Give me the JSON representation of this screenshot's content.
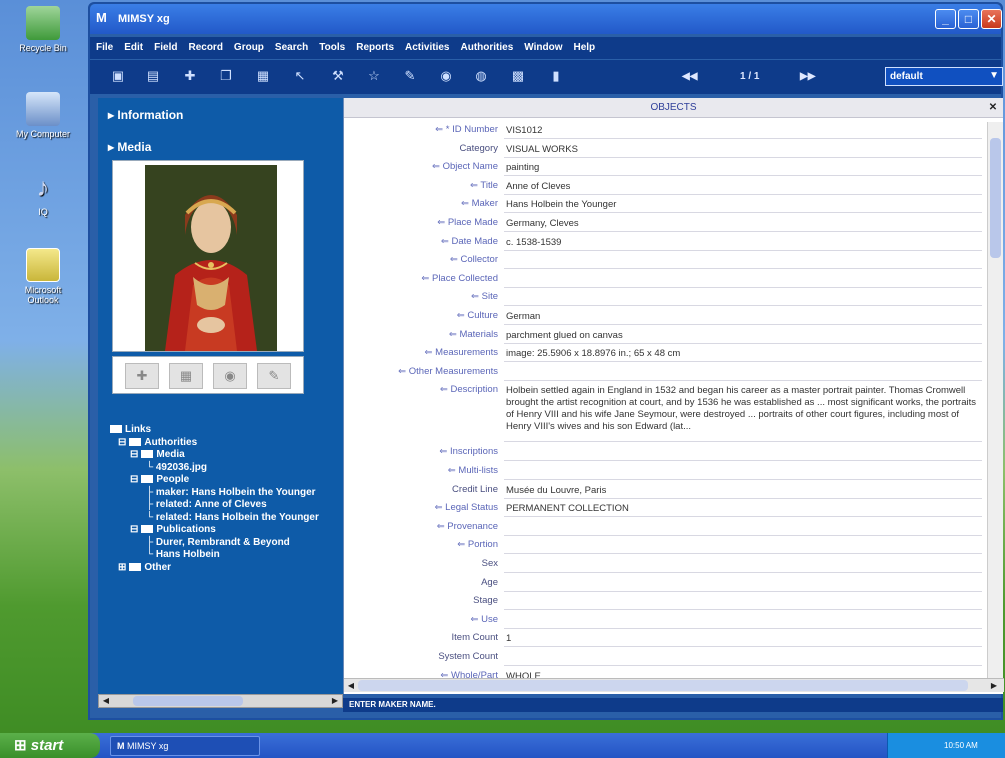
{
  "desktop": {
    "icons": [
      {
        "label": "Recycle Bin"
      },
      {
        "label": "My Computer"
      },
      {
        "label": "IQ"
      },
      {
        "label": "Microsoft Outlook"
      }
    ]
  },
  "window": {
    "app_icon_letter": "M",
    "title": "MIMSY xg",
    "min_glyph": "_",
    "max_glyph": "□",
    "close_glyph": "✕"
  },
  "menu": [
    "File",
    "Edit",
    "Field",
    "Record",
    "Group",
    "Search",
    "Tools",
    "Reports",
    "Activities",
    "Authorities",
    "Window",
    "Help"
  ],
  "toolbar": {
    "first_glyph": "◀◀",
    "page_indicator": "1 / 1",
    "last_glyph": "▶▶",
    "profile_value": "default",
    "dropdown_glyph": "▼"
  },
  "left_panel": {
    "information_label": "Information",
    "media_label": "Media",
    "links_label": "Links",
    "authorities_label": "Authorities",
    "media_folder": "Media",
    "media_file": "492036.jpg",
    "people_label": "People",
    "people": [
      "maker: Hans Holbein the Younger",
      "related: Anne of Cleves",
      "related: Hans Holbein the Younger"
    ],
    "publications_label": "Publications",
    "publications": [
      "Durer, Rembrandt & Beyond",
      "Hans Holbein"
    ],
    "other_label": "Other"
  },
  "objects": {
    "header": "OBJECTS",
    "close_glyph": "✕",
    "fields": [
      {
        "label": "* ID Number",
        "value": "VIS1012",
        "link": true
      },
      {
        "label": "Category",
        "value": "VISUAL WORKS",
        "link": false
      },
      {
        "label": "Object Name",
        "value": "painting",
        "link": true
      },
      {
        "label": "Title",
        "value": "Anne of Cleves",
        "link": true
      },
      {
        "label": "Maker",
        "value": "Hans Holbein the Younger",
        "link": true
      },
      {
        "label": "Place Made",
        "value": "Germany, Cleves",
        "link": true
      },
      {
        "label": "Date Made",
        "value": "c. 1538-1539",
        "link": true
      },
      {
        "label": "Collector",
        "value": "",
        "link": true
      },
      {
        "label": "Place Collected",
        "value": "",
        "link": true
      },
      {
        "label": "Site",
        "value": "",
        "link": true
      },
      {
        "label": "Culture",
        "value": "German",
        "link": true
      },
      {
        "label": "Materials",
        "value": "parchment glued on canvas",
        "link": true
      },
      {
        "label": "Measurements",
        "value": "image: 25.5906 x 18.8976 in.; 65 x 48 cm",
        "link": true
      },
      {
        "label": "Other Measurements",
        "value": "",
        "link": true
      },
      {
        "label": "Description",
        "value": "Holbein settled again in England in 1532 and began his career as a master portrait painter. Thomas Cromwell brought the artist recognition at court, and by 1536 he was established as ... most significant works, the portraits of Henry VIII and his wife Jane Seymour, were destroyed ... portraits of other court figures, including most of Henry VIII's wives and his son Edward (lat...",
        "link": true,
        "multi": true
      },
      {
        "label": "Inscriptions",
        "value": "",
        "link": true
      },
      {
        "label": "Multi-lists",
        "value": "",
        "link": true
      },
      {
        "label": "Credit Line",
        "value": "Musée du Louvre, Paris",
        "link": false
      },
      {
        "label": "Legal Status",
        "value": "PERMANENT COLLECTION",
        "link": true
      },
      {
        "label": "Provenance",
        "value": "",
        "link": true
      },
      {
        "label": "Portion",
        "value": "",
        "link": true
      },
      {
        "label": "Sex",
        "value": "",
        "link": false
      },
      {
        "label": "Age",
        "value": "",
        "link": false
      },
      {
        "label": "Stage",
        "value": "",
        "link": false
      },
      {
        "label": "Use",
        "value": "",
        "link": true
      },
      {
        "label": "Item Count",
        "value": "1",
        "link": false
      },
      {
        "label": "System Count",
        "value": "",
        "link": false
      },
      {
        "label": "Whole/Part",
        "value": "WHOLE",
        "link": true
      }
    ]
  },
  "statusbar": {
    "text": "ENTER MAKER NAME."
  },
  "taskbar": {
    "start_label": "start",
    "task_label": "MIMSY xg",
    "clock": "10:50 AM"
  },
  "colors": {
    "window_blue": "#0e3b8a",
    "panel_blue": "#0e5ba8",
    "label_blue": "#5b66b8"
  }
}
